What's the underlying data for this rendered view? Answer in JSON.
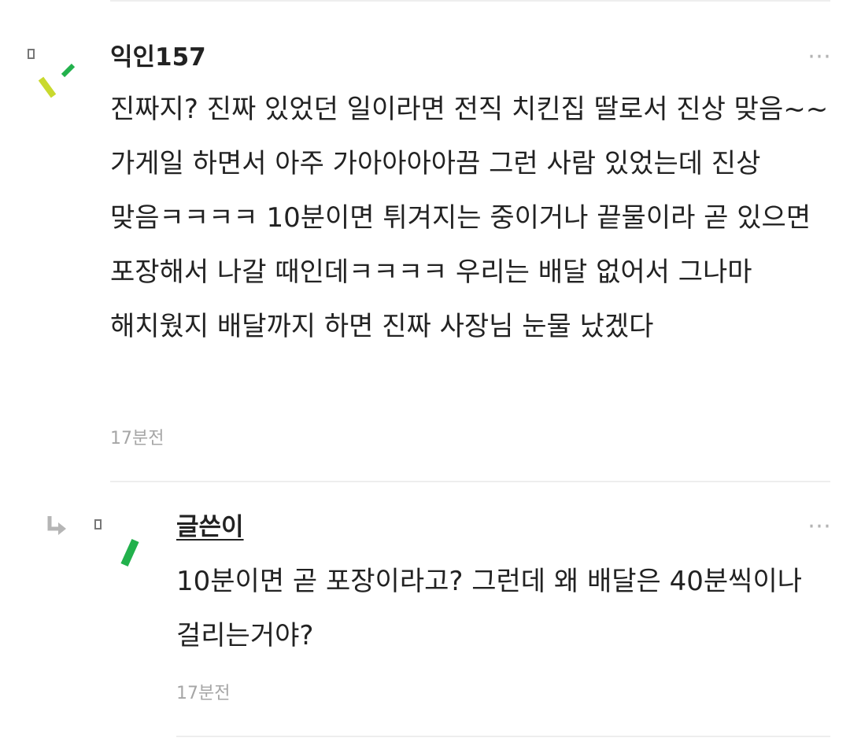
{
  "comments": [
    {
      "author": "익인157",
      "body": "진짜지? 진짜 있었던 일이라면 전직 치킨집 딸로서 진상 맞음~~ 가게일 하면서 아주 가아아아아끔 그런 사람 있었는데 진상 맞음ㅋㅋㅋㅋ 10분이면 튀겨지는 중이거나 끝물이라 곧 있으면 포장해서 나갈 때인데ㅋㅋㅋㅋ 우리는 배달 없어서 그나마 해치웠지 배달까지 하면 진짜 사장님 눈물 났겠다",
      "time": "17분전",
      "more": "⋯",
      "avatar_icon": "random-stroke-avatar-icon",
      "avatar_colors": [
        "#c9d92e",
        "#22b14c"
      ]
    },
    {
      "author": "글쓴이",
      "body": "10분이면 곧 포장이라고? 그런데 왜 배달은 40분씩이나 걸리는거야?",
      "time": "17분전",
      "more": "⋯",
      "is_reply": true,
      "reply_icon": "reply-arrow-icon",
      "avatar_icon": "random-stroke-avatar-icon",
      "avatar_colors": [
        "#22b14c"
      ]
    }
  ]
}
